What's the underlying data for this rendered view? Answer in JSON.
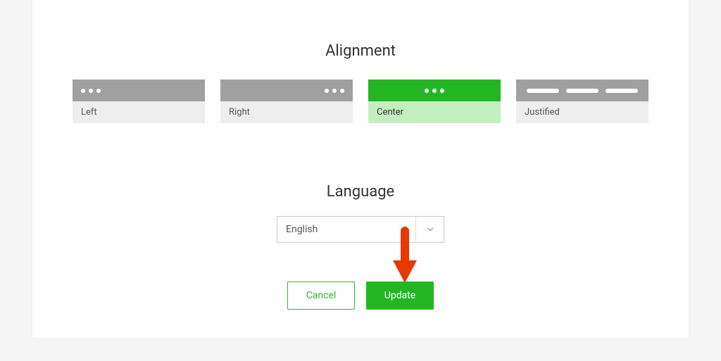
{
  "alignment": {
    "title": "Alignment",
    "options": [
      {
        "label": "Left"
      },
      {
        "label": "Right"
      },
      {
        "label": "Center"
      },
      {
        "label": "Justified"
      }
    ],
    "selected_index": 2
  },
  "language": {
    "title": "Language",
    "selected": "English"
  },
  "buttons": {
    "cancel_label": "Cancel",
    "update_label": "Update"
  },
  "colors": {
    "accent": "#22b722"
  }
}
